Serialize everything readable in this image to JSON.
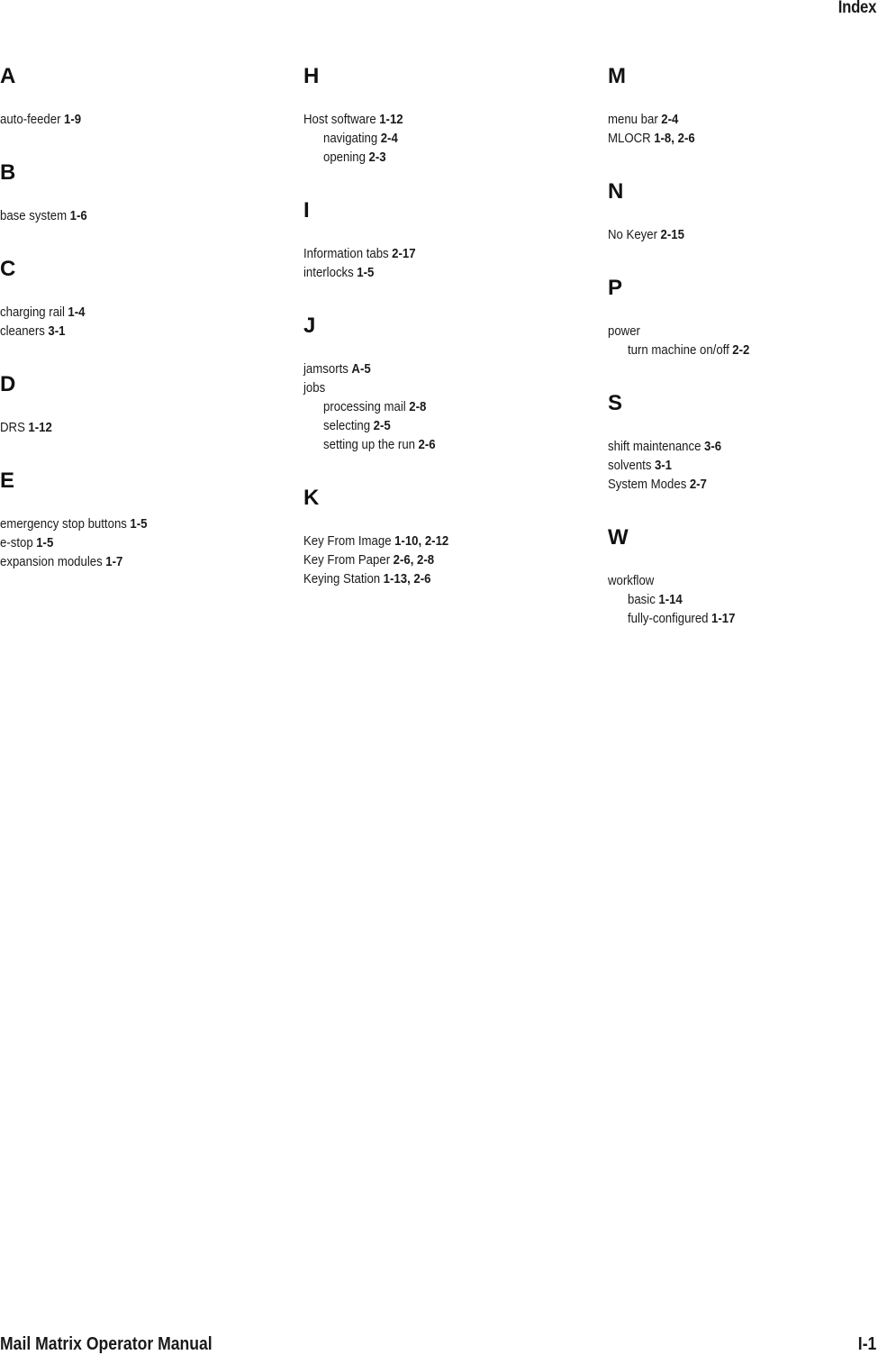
{
  "header": {
    "title": "Index"
  },
  "footer": {
    "manual_title": "Mail Matrix Operator Manual",
    "page_number": "I-1"
  },
  "columns": [
    {
      "sections": [
        {
          "letter": "A",
          "entries": [
            {
              "term": "auto-feeder",
              "pages": "1-9",
              "level": 0
            }
          ]
        },
        {
          "letter": "B",
          "entries": [
            {
              "term": "base system",
              "pages": "1-6",
              "level": 0
            }
          ]
        },
        {
          "letter": "C",
          "entries": [
            {
              "term": "charging rail",
              "pages": "1-4",
              "level": 0
            },
            {
              "term": "cleaners",
              "pages": "3-1",
              "level": 0
            }
          ]
        },
        {
          "letter": "D",
          "entries": [
            {
              "term": "DRS",
              "pages": "1-12",
              "level": 0
            }
          ]
        },
        {
          "letter": "E",
          "entries": [
            {
              "term": "emergency stop buttons",
              "pages": "1-5",
              "level": 0
            },
            {
              "term": "e-stop",
              "pages": "1-5",
              "level": 0
            },
            {
              "term": "expansion modules",
              "pages": "1-7",
              "level": 0
            }
          ]
        }
      ]
    },
    {
      "sections": [
        {
          "letter": "H",
          "entries": [
            {
              "term": "Host software",
              "pages": "1-12",
              "level": 0
            },
            {
              "term": "navigating",
              "pages": "2-4",
              "level": 1
            },
            {
              "term": "opening",
              "pages": "2-3",
              "level": 1
            }
          ]
        },
        {
          "letter": "I",
          "entries": [
            {
              "term": "Information tabs",
              "pages": "2-17",
              "level": 0
            },
            {
              "term": "interlocks",
              "pages": "1-5",
              "level": 0
            }
          ]
        },
        {
          "letter": "J",
          "entries": [
            {
              "term": "jamsorts",
              "pages": "A-5",
              "level": 0
            },
            {
              "term": "jobs",
              "pages": "",
              "level": 0
            },
            {
              "term": "processing mail",
              "pages": "2-8",
              "level": 1
            },
            {
              "term": "selecting",
              "pages": "2-5",
              "level": 1
            },
            {
              "term": "setting up the run",
              "pages": "2-6",
              "level": 1
            }
          ]
        },
        {
          "letter": "K",
          "entries": [
            {
              "term": "Key From Image",
              "pages": "1-10, 2-12",
              "level": 0
            },
            {
              "term": "Key From Paper",
              "pages": "2-6, 2-8",
              "level": 0
            },
            {
              "term": "Keying Station",
              "pages": "1-13, 2-6",
              "level": 0
            }
          ]
        }
      ]
    },
    {
      "sections": [
        {
          "letter": "M",
          "entries": [
            {
              "term": "menu bar",
              "pages": "2-4",
              "level": 0
            },
            {
              "term": "MLOCR",
              "pages": "1-8, 2-6",
              "level": 0
            }
          ]
        },
        {
          "letter": "N",
          "entries": [
            {
              "term": "No Keyer",
              "pages": "2-15",
              "level": 0
            }
          ]
        },
        {
          "letter": "P",
          "entries": [
            {
              "term": "power",
              "pages": "",
              "level": 0
            },
            {
              "term": "turn machine on/off",
              "pages": "2-2",
              "level": 1
            }
          ]
        },
        {
          "letter": "S",
          "entries": [
            {
              "term": "shift maintenance",
              "pages": "3-6",
              "level": 0
            },
            {
              "term": "solvents",
              "pages": "3-1",
              "level": 0
            },
            {
              "term": "System Modes",
              "pages": "2-7",
              "level": 0
            }
          ]
        },
        {
          "letter": "W",
          "entries": [
            {
              "term": "workflow",
              "pages": "",
              "level": 0
            },
            {
              "term": "basic",
              "pages": "1-14",
              "level": 1
            },
            {
              "term": "fully-configured",
              "pages": "1-17",
              "level": 1
            }
          ]
        }
      ]
    }
  ]
}
